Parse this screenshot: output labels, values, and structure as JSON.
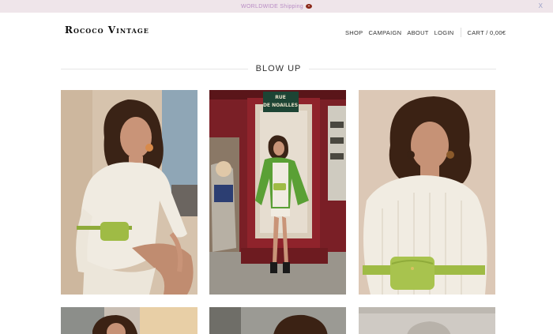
{
  "announcement": {
    "text": "WORLDWIDE Shipping",
    "close": "X"
  },
  "brand": "Rococo Vintage",
  "nav": {
    "shop": "SHOP",
    "campaign": "CAMPAIGN",
    "about": "ABOUT",
    "login": "LOGIN",
    "cart": "CART / 0,00€"
  },
  "section": {
    "title": "BLOW UP"
  },
  "sign": {
    "line1": "RUE",
    "line2": "DE NOAILLES"
  }
}
